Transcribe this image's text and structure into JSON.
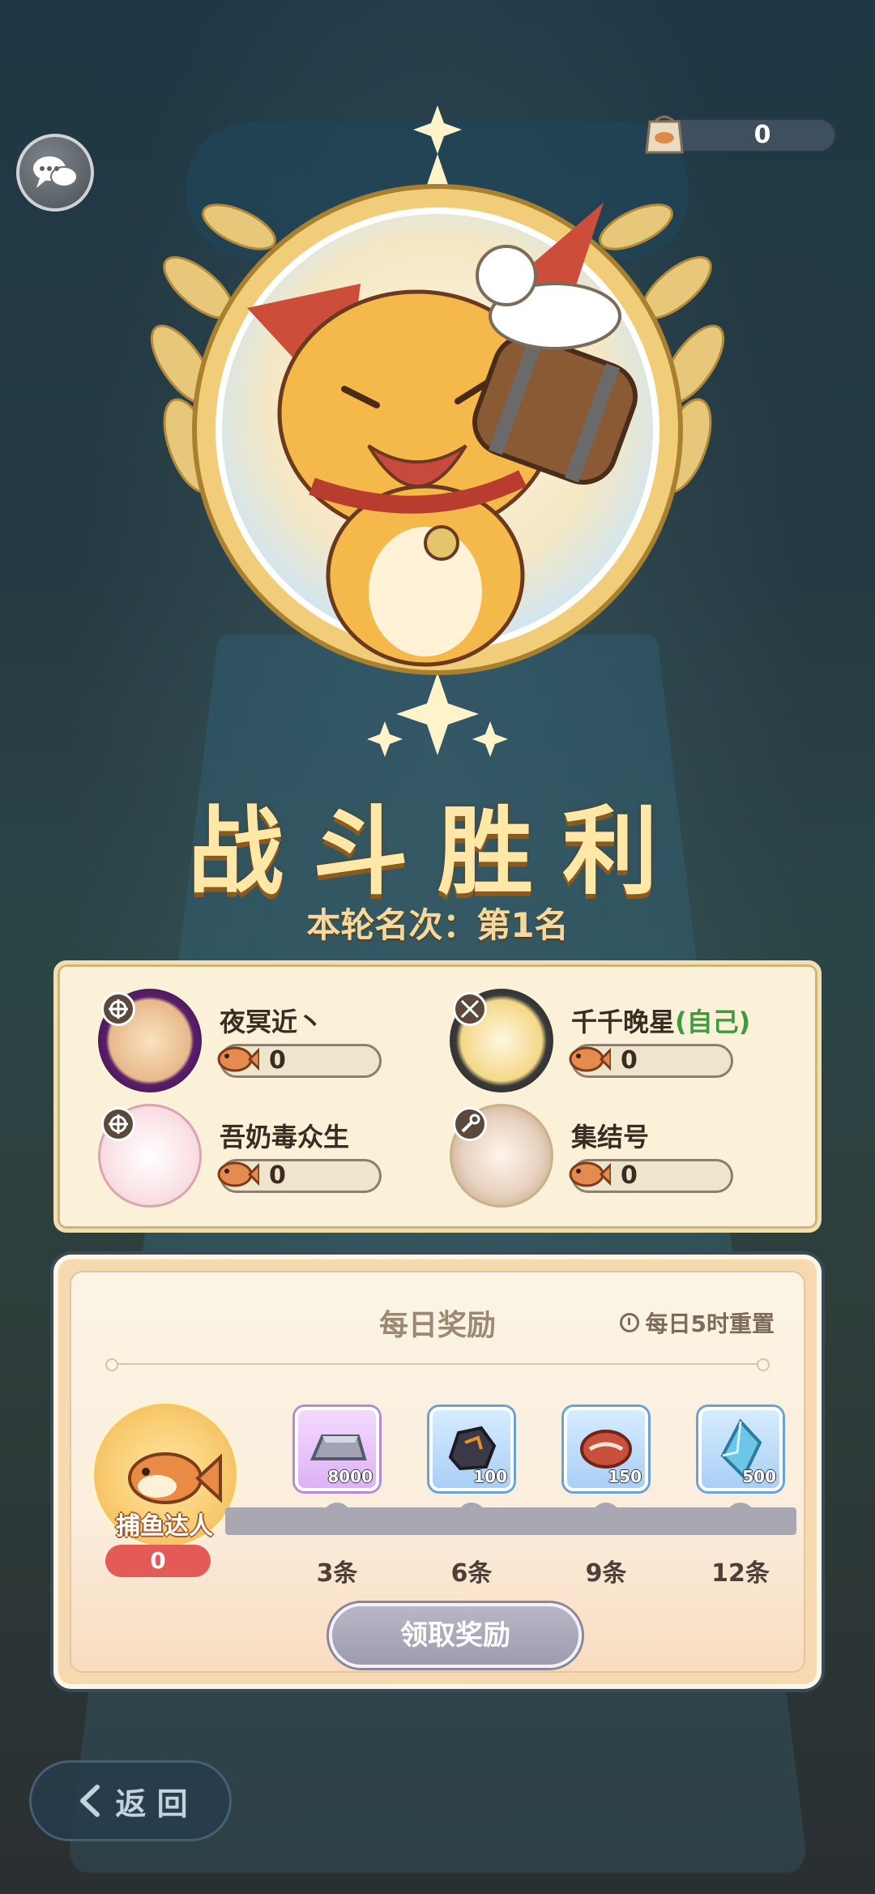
{
  "header": {
    "currency_value": "0"
  },
  "result": {
    "title": "战斗胜利",
    "rank_text": "本轮名次：第1名"
  },
  "players": [
    {
      "name": "夜冥近丶",
      "score": "0",
      "is_self": false
    },
    {
      "name": "千千晚星",
      "self_tag": "(自己)",
      "score": "0",
      "is_self": true
    },
    {
      "name": "吾奶毒众生",
      "score": "0",
      "is_self": false
    },
    {
      "name": "集结号",
      "score": "0",
      "is_self": false
    }
  ],
  "daily": {
    "title": "每日奖励",
    "reset_text": "每日5时重置",
    "master_label": "捕鱼达人",
    "master_count": "0",
    "rewards": [
      {
        "qty": "8000",
        "tier": "3条",
        "item": "silver-ingot-icon"
      },
      {
        "qty": "100",
        "tier": "6条",
        "item": "ore-icon"
      },
      {
        "qty": "150",
        "tier": "9条",
        "item": "meat-icon"
      },
      {
        "qty": "500",
        "tier": "12条",
        "item": "crystal-icon"
      }
    ],
    "progress": 0,
    "claim_label": "领取奖励"
  },
  "nav": {
    "back_label": "返 回"
  },
  "colors": {
    "accent_gold": "#ffe7a8",
    "self_tag": "#3f9a3e",
    "count_badge": "#e35a57",
    "disabled_button": "#a9a8b2"
  }
}
